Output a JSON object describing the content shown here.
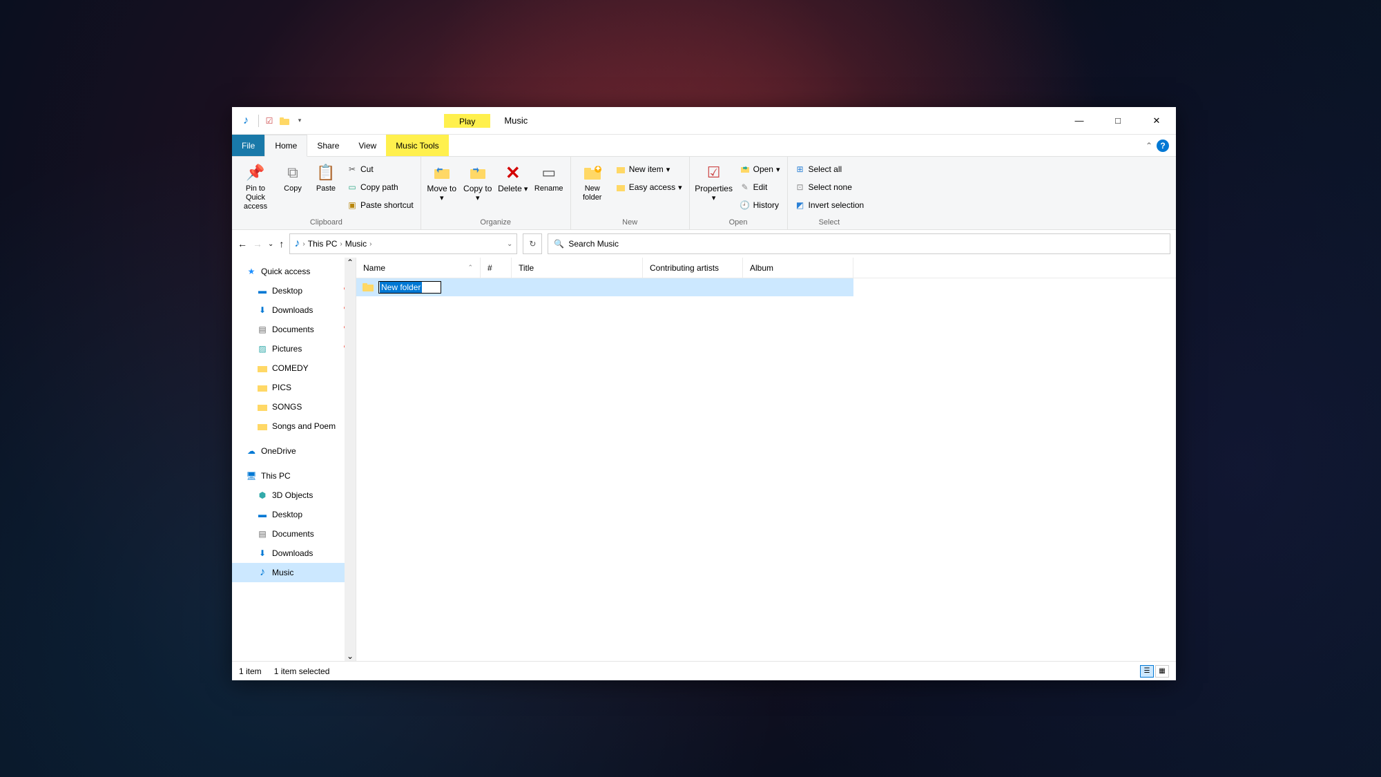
{
  "title": "Music",
  "play_tab": "Play",
  "tabs": {
    "file": "File",
    "home": "Home",
    "share": "Share",
    "view": "View",
    "music_tools": "Music Tools"
  },
  "ribbon": {
    "clipboard": {
      "label": "Clipboard",
      "pin": "Pin to Quick access",
      "copy": "Copy",
      "paste": "Paste",
      "cut": "Cut",
      "copy_path": "Copy path",
      "paste_shortcut": "Paste shortcut"
    },
    "organize": {
      "label": "Organize",
      "move_to": "Move to",
      "copy_to": "Copy to",
      "delete": "Delete",
      "rename": "Rename"
    },
    "new": {
      "label": "New",
      "new_folder": "New folder",
      "new_item": "New item",
      "easy_access": "Easy access"
    },
    "open": {
      "label": "Open",
      "properties": "Properties",
      "open": "Open",
      "edit": "Edit",
      "history": "History"
    },
    "select": {
      "label": "Select",
      "select_all": "Select all",
      "select_none": "Select none",
      "invert": "Invert selection"
    }
  },
  "breadcrumb": {
    "root": "This PC",
    "folder": "Music"
  },
  "search_placeholder": "Search Music",
  "sidebar": {
    "quick_access": "Quick access",
    "qa_items": [
      {
        "label": "Desktop",
        "pinned": true
      },
      {
        "label": "Downloads",
        "pinned": true
      },
      {
        "label": "Documents",
        "pinned": true
      },
      {
        "label": "Pictures",
        "pinned": true
      },
      {
        "label": "COMEDY",
        "pinned": false
      },
      {
        "label": "PICS",
        "pinned": false
      },
      {
        "label": "SONGS",
        "pinned": false
      },
      {
        "label": "Songs and Poem",
        "pinned": false
      }
    ],
    "onedrive": "OneDrive",
    "this_pc": "This PC",
    "pc_items": [
      {
        "label": "3D Objects"
      },
      {
        "label": "Desktop"
      },
      {
        "label": "Documents"
      },
      {
        "label": "Downloads"
      },
      {
        "label": "Music",
        "selected": true
      }
    ]
  },
  "columns": {
    "name": "Name",
    "num": "#",
    "title": "Title",
    "artists": "Contributing artists",
    "album": "Album"
  },
  "new_folder_name": "New folder",
  "status": {
    "items": "1 item",
    "selected": "1 item selected"
  }
}
